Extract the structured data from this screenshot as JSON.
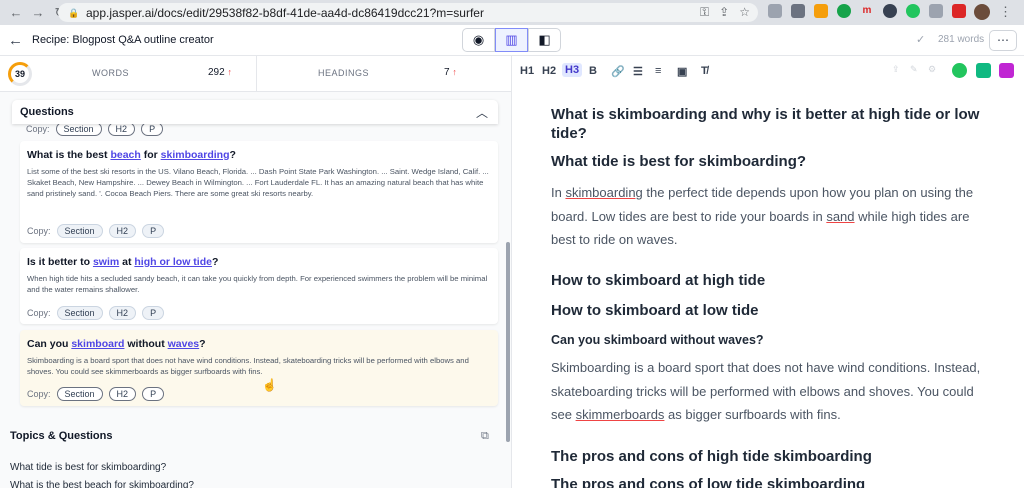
{
  "browser": {
    "url": "app.jasper.ai/docs/edit/29538f82-b8df-41de-aa4d-dc86419dcc21?m=surfer"
  },
  "topbar": {
    "title": "Recipe: Blogpost Q&A outline creator",
    "word_count": "281 words"
  },
  "stats": {
    "score": "39",
    "words_label": "WORDS",
    "words_value": "292",
    "headings_label": "HEADINGS",
    "headings_value": "7"
  },
  "questions": {
    "header": "Questions",
    "copy_label": "Copy:",
    "pill_section": "Section",
    "pill_h2": "H2",
    "pill_p": "P",
    "cards": [
      {
        "title_parts": [
          "What is the best ",
          "beach",
          " for ",
          "skimboarding",
          "?"
        ],
        "body": "List some of the best ski resorts in the US. Vilano Beach, Florida. ... Dash Point State Park Washington. ... Saint. Wedge Island, Calif. ... Skaket Beach, New Hampshire. ... Dewey Beach in Wilmington. ... Fort Lauderdale FL. It has an amazing natural beach that has white sand pristinely sand. '. Cocoa Beach Piers. There are some great ski resorts nearby."
      },
      {
        "title_parts": [
          "Is it better to ",
          "swim",
          " at ",
          "high or low tide",
          "?"
        ],
        "body": "When high tide hits a secluded sandy beach, it can take you quickly from depth. For experienced swimmers the problem will be minimal and the water remains shallower."
      },
      {
        "title_parts": [
          "Can you ",
          "skimboard",
          " without ",
          "waves",
          "?"
        ],
        "body": "Skimboarding is a board sport that does not have wind conditions. Instead, skateboarding tricks will be performed with elbows and shoves. You could see skimmerboards as bigger surfboards with fins."
      }
    ]
  },
  "topics": {
    "title": "Topics & Questions",
    "items": [
      "What tide is best for skimboarding?",
      "What is the best beach for skimboarding?"
    ]
  },
  "toolbar": {
    "h1": "H1",
    "h2": "H2",
    "h3": "H3",
    "bold": "B"
  },
  "editor": {
    "h_title": "What is skimboarding and why is it better at high tide or low tide?",
    "h_tide": "What tide is best for skimboarding?",
    "p1_parts": [
      "In ",
      "skimboarding",
      " the perfect tide depends upon how you plan on using the board. Low tides are best to ride your boards in ",
      "sand",
      " while high tides are best to ride on waves."
    ],
    "h_high": "How to skimboard at high tide",
    "h_low": "How to skimboard at low tide",
    "h_waves": "Can you skimboard without waves?",
    "p2_parts": [
      "Skimboarding is a board sport that does not have wind conditions. Instead, skateboarding tricks will be performed with elbows and shoves. You could see ",
      "skimmerboards",
      " as bigger surfboards with fins."
    ],
    "h_pros_high": "The pros and cons of high tide skimboarding",
    "h_pros_low": "The pros and cons of low tide skimboarding"
  }
}
